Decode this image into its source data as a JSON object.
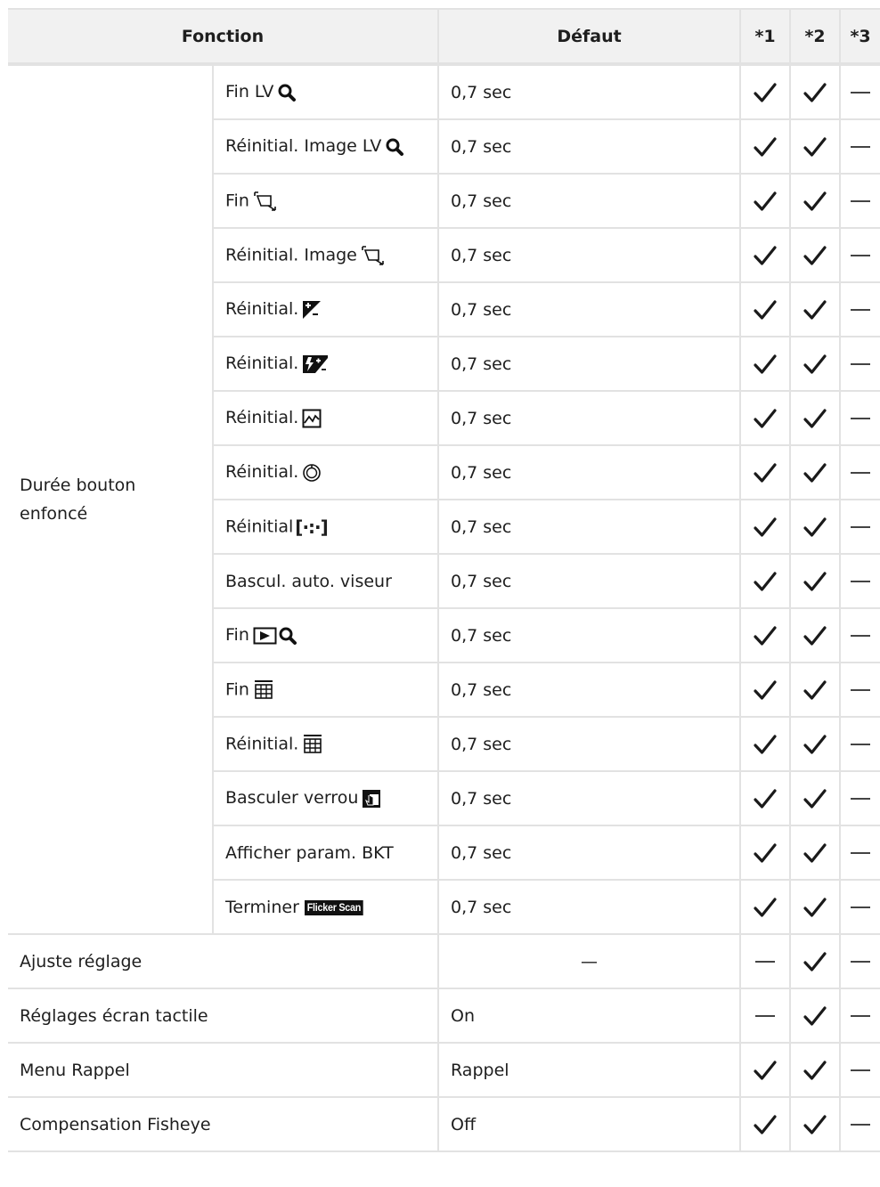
{
  "header": {
    "function": "Fonction",
    "default": "Défaut",
    "col1": "*1",
    "col2": "*2",
    "col3": "*3"
  },
  "group": {
    "label": "Durée bouton enfoncé",
    "rows": [
      {
        "label": "Fin LV",
        "icon": "magnifier-icon",
        "default": "0,7 sec",
        "c1": "check",
        "c2": "check",
        "c3": "dash"
      },
      {
        "label": "Réinitial. Image LV",
        "icon": "magnifier-icon",
        "default": "0,7 sec",
        "c1": "check",
        "c2": "check",
        "c3": "dash"
      },
      {
        "label": "Fin",
        "icon": "keystone-icon",
        "default": "0,7 sec",
        "c1": "check",
        "c2": "check",
        "c3": "dash"
      },
      {
        "label": "Réinitial. Image",
        "icon": "keystone-icon",
        "default": "0,7 sec",
        "c1": "check",
        "c2": "check",
        "c3": "dash"
      },
      {
        "label": "Réinitial.",
        "icon": "exposure-comp-icon",
        "default": "0,7 sec",
        "c1": "check",
        "c2": "check",
        "c3": "dash"
      },
      {
        "label": "Réinitial.",
        "icon": "flash-comp-icon",
        "default": "0,7 sec",
        "c1": "check",
        "c2": "check",
        "c3": "dash"
      },
      {
        "label": "Réinitial.",
        "icon": "highlight-shadow-icon",
        "default": "0,7 sec",
        "c1": "check",
        "c2": "check",
        "c3": "dash"
      },
      {
        "label": "Réinitial.",
        "icon": "dial-icon",
        "default": "0,7 sec",
        "c1": "check",
        "c2": "check",
        "c3": "dash"
      },
      {
        "label": "Réinitial",
        "icon": "af-target-icon",
        "icon_text": "[·:·]",
        "default": "0,7 sec",
        "c1": "check",
        "c2": "check",
        "c3": "dash"
      },
      {
        "label": "Bascul. auto. viseur",
        "icon": "",
        "default": "0,7 sec",
        "c1": "check",
        "c2": "check",
        "c3": "dash"
      },
      {
        "label": "Fin",
        "icon": "playback-zoom-icon",
        "default": "0,7 sec",
        "c1": "check",
        "c2": "check",
        "c3": "dash"
      },
      {
        "label": "Fin",
        "icon": "multi-grid-icon",
        "default": "0,7 sec",
        "c1": "check",
        "c2": "check",
        "c3": "dash"
      },
      {
        "label": "Réinitial.",
        "icon": "multi-grid-icon",
        "default": "0,7 sec",
        "c1": "check",
        "c2": "check",
        "c3": "dash"
      },
      {
        "label": "Basculer verrou",
        "icon": "touch-lock-icon",
        "default": "0,7 sec",
        "c1": "check",
        "c2": "check",
        "c3": "dash"
      },
      {
        "label": "Afficher param. BKT",
        "icon": "",
        "default": "0,7 sec",
        "c1": "check",
        "c2": "check",
        "c3": "dash"
      },
      {
        "label": "Terminer",
        "icon": "flicker-scan-icon",
        "icon_text": "Flicker Scan",
        "default": "0,7 sec",
        "c1": "check",
        "c2": "check",
        "c3": "dash"
      }
    ]
  },
  "rows": [
    {
      "label": "Ajuste réglage",
      "default": "—",
      "default_center": true,
      "c1": "dash",
      "c2": "check",
      "c3": "dash"
    },
    {
      "label": "Réglages écran tactile",
      "default": "On",
      "c1": "dash",
      "c2": "check",
      "c3": "dash"
    },
    {
      "label": "Menu Rappel",
      "default": "Rappel",
      "c1": "check",
      "c2": "check",
      "c3": "dash"
    },
    {
      "label": "Compensation Fisheye",
      "default": "Off",
      "c1": "check",
      "c2": "check",
      "c3": "dash"
    }
  ]
}
